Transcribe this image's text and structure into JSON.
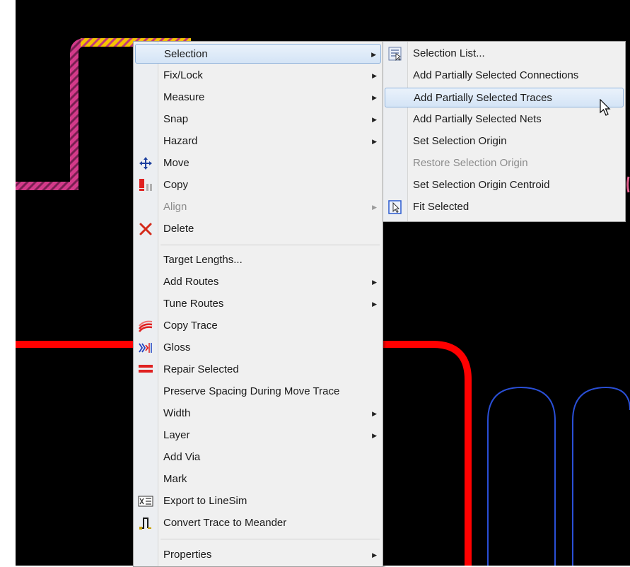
{
  "main_menu": {
    "items": [
      {
        "label": "Selection",
        "submenu": true,
        "highlighted": true
      },
      {
        "label": "Fix/Lock",
        "submenu": true
      },
      {
        "label": "Measure",
        "submenu": true
      },
      {
        "label": "Snap",
        "submenu": true
      },
      {
        "label": "Hazard",
        "submenu": true
      },
      {
        "label": "Move",
        "icon": "move-arrows-icon"
      },
      {
        "label": "Copy",
        "icon": "copy-icon"
      },
      {
        "label": "Align",
        "submenu": true,
        "disabled": true
      },
      {
        "label": "Delete",
        "icon": "delete-x-icon"
      },
      {
        "label": "Target Lengths..."
      },
      {
        "label": "Add Routes",
        "submenu": true
      },
      {
        "label": "Tune Routes",
        "submenu": true
      },
      {
        "label": "Copy Trace",
        "icon": "copy-trace-icon"
      },
      {
        "label": "Gloss",
        "icon": "gloss-icon"
      },
      {
        "label": "Repair Selected",
        "icon": "repair-icon"
      },
      {
        "label": "Preserve Spacing During Move Trace"
      },
      {
        "label": "Width",
        "submenu": true
      },
      {
        "label": "Layer",
        "submenu": true
      },
      {
        "label": "Add Via"
      },
      {
        "label": "Mark"
      },
      {
        "label": "Export to LineSim",
        "icon": "export-linesim-icon"
      },
      {
        "label": "Convert Trace to Meander",
        "icon": "meander-icon"
      },
      {
        "label": "Properties",
        "submenu": true
      }
    ]
  },
  "sub_menu": {
    "items": [
      {
        "label": "Selection List...",
        "icon": "selection-list-icon"
      },
      {
        "label": "Add Partially Selected Connections"
      },
      {
        "label": "Add Partially Selected Traces",
        "highlighted": true
      },
      {
        "label": "Add Partially Selected Nets"
      },
      {
        "label": "Set Selection Origin"
      },
      {
        "label": "Restore Selection Origin",
        "disabled": true
      },
      {
        "label": "Set Selection Origin Centroid"
      },
      {
        "label": "Fit Selected",
        "icon": "fit-selected-icon"
      }
    ]
  },
  "colors": {
    "background": "#000000",
    "trace_red": "#ff0000",
    "trace_hatched": "#ff4fa0",
    "trace_hatched_alt": "#f5c400",
    "meander_blue": "#2a4fd6"
  }
}
